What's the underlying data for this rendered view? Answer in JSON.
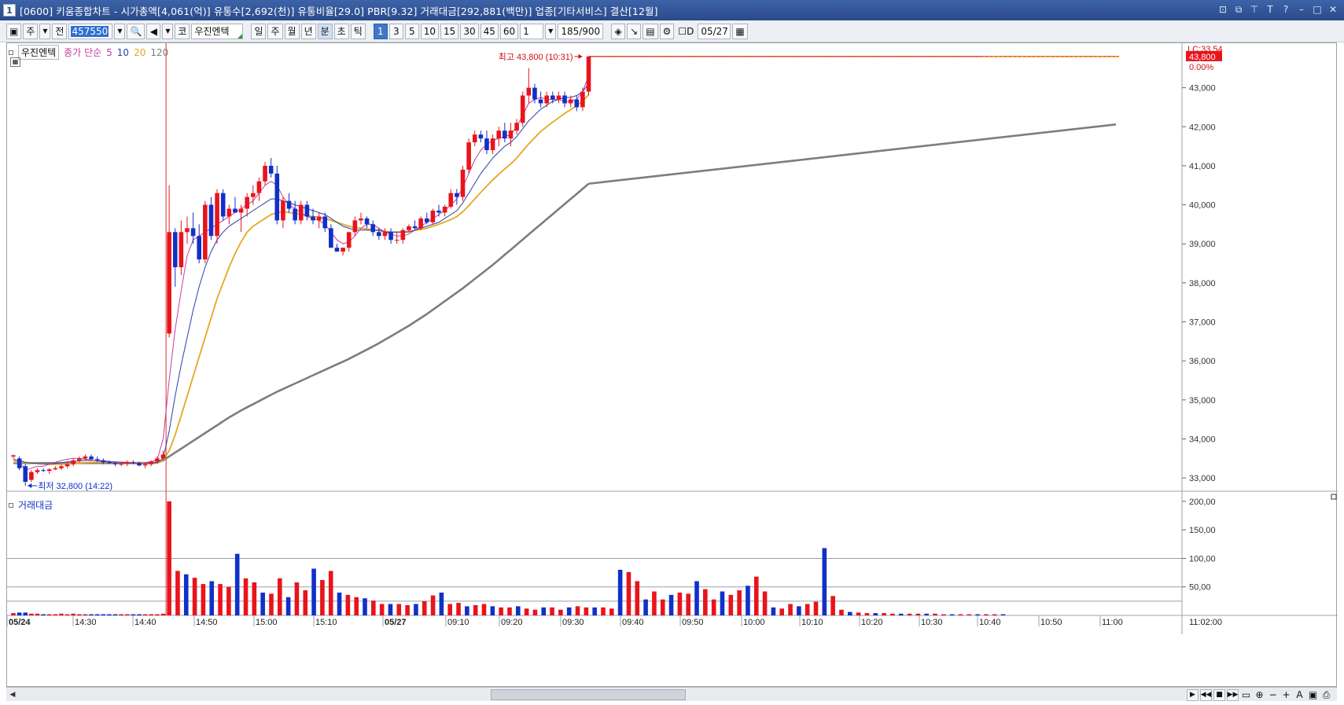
{
  "window": {
    "number": "1",
    "title": "[0600] 키움종합차트 - 시가총액[4,061(억)] 유통수[2,692(천)] 유통비율[29.0] PBR[9.32] 거래대금[292,881(백만)] 업종[기타서비스] 결산[12월]",
    "buttons": [
      "⊡",
      "⧉",
      "⊤",
      "T",
      "?",
      "–",
      "□",
      "✕"
    ]
  },
  "toolbar": {
    "period_btn": "주",
    "range_btn": "전",
    "code_value": "457550",
    "market_btn": "코",
    "stock_name": "우진엔텍",
    "period_tabs": [
      "일",
      "주",
      "월",
      "년",
      "분",
      "초",
      "틱"
    ],
    "active_period": "분",
    "minute_intervals": [
      "1",
      "3",
      "5",
      "10",
      "15",
      "30",
      "45",
      "60"
    ],
    "active_interval": "1",
    "count_value": "1",
    "bar_count": "185/900",
    "d_label": "D",
    "date_value": "05/27"
  },
  "price_panel": {
    "stock_name": "우진엔텍",
    "ma_label": "종가 단순",
    "ma_periods": [
      {
        "label": "5",
        "color": "#c43ca0"
      },
      {
        "label": "10",
        "color": "#2a3fa8"
      },
      {
        "label": "20",
        "color": "#e6a820"
      },
      {
        "label": "120",
        "color": "#7d7d7d"
      }
    ],
    "lc_label": "LC:33.54",
    "current_price": "43,800",
    "current_change": "0.00%",
    "high_marker": "최고 43,800 (10:31)",
    "low_marker": "최저 32,800 (14:22)",
    "y_ticks": [
      "43,000",
      "42,000",
      "41,000",
      "40,000",
      "39,000",
      "38,000",
      "37,000",
      "36,000",
      "35,000",
      "34,000",
      "33,000"
    ]
  },
  "volume_panel": {
    "label": "거래대금",
    "y_ticks": [
      "200,00",
      "150,00",
      "100,00",
      "50,00"
    ]
  },
  "x_axis": {
    "labels": [
      "05/24",
      "14:30",
      "14:40",
      "14:50",
      "15:00",
      "15:10",
      "05/27",
      "09:10",
      "09:20",
      "09:30",
      "09:40",
      "09:50",
      "10:00",
      "10:10",
      "10:20",
      "10:30",
      "10:40",
      "10:50",
      "11:00"
    ],
    "right_label": "11:02:00"
  },
  "colors": {
    "up": "#e8141c",
    "down": "#1030c8",
    "ma5": "#c43ca0",
    "ma10": "#2a3fa8",
    "ma20": "#e6a820",
    "ma120": "#7d7d7d",
    "title_bar": "#2f5295"
  },
  "chart_data": {
    "type": "candlestick",
    "title": "우진엔텍",
    "high": 43800,
    "low": 32800,
    "ylim": [
      32700,
      44100
    ],
    "candles": [
      [
        33550,
        33600,
        33500,
        33580
      ],
      [
        33500,
        33550,
        33200,
        33250
      ],
      [
        33300,
        33350,
        32800,
        32900
      ],
      [
        32950,
        33200,
        32900,
        33150
      ],
      [
        33150,
        33250,
        33100,
        33200
      ],
      [
        33200,
        33250,
        33150,
        33180
      ],
      [
        33180,
        33250,
        33100,
        33220
      ],
      [
        33220,
        33300,
        33200,
        33250
      ],
      [
        33250,
        33350,
        33200,
        33300
      ],
      [
        33300,
        33400,
        33250,
        33350
      ],
      [
        33350,
        33500,
        33300,
        33450
      ],
      [
        33450,
        33550,
        33400,
        33500
      ],
      [
        33500,
        33600,
        33450,
        33550
      ],
      [
        33550,
        33600,
        33450,
        33480
      ],
      [
        33480,
        33550,
        33400,
        33450
      ],
      [
        33450,
        33500,
        33350,
        33400
      ],
      [
        33400,
        33450,
        33350,
        33380
      ],
      [
        33380,
        33420,
        33300,
        33350
      ],
      [
        33350,
        33400,
        33300,
        33360
      ],
      [
        33360,
        33450,
        33300,
        33400
      ],
      [
        33400,
        33450,
        33350,
        33380
      ],
      [
        33380,
        33420,
        33300,
        33320
      ],
      [
        33320,
        33400,
        33250,
        33350
      ],
      [
        33350,
        33450,
        33300,
        33420
      ],
      [
        33420,
        33550,
        33400,
        33500
      ],
      [
        33500,
        33700,
        33450,
        33600
      ],
      [
        36700,
        40500,
        36600,
        39300
      ],
      [
        39300,
        39400,
        37900,
        38400
      ],
      [
        38400,
        39600,
        38200,
        39300
      ],
      [
        39300,
        39700,
        39000,
        39400
      ],
      [
        39400,
        39800,
        39000,
        39200
      ],
      [
        39200,
        39500,
        38500,
        38600
      ],
      [
        38600,
        40100,
        38500,
        40000
      ],
      [
        40000,
        40200,
        39100,
        39200
      ],
      [
        39200,
        40400,
        39000,
        40300
      ],
      [
        40300,
        40400,
        39600,
        39700
      ],
      [
        39700,
        40000,
        39500,
        39900
      ],
      [
        39900,
        40200,
        39800,
        39800
      ],
      [
        39800,
        40000,
        39300,
        39900
      ],
      [
        39900,
        40300,
        39700,
        40200
      ],
      [
        40200,
        40500,
        40000,
        40300
      ],
      [
        40300,
        40700,
        40100,
        40600
      ],
      [
        40600,
        41100,
        40500,
        41000
      ],
      [
        41000,
        41200,
        40700,
        40800
      ],
      [
        40800,
        41000,
        39500,
        39600
      ],
      [
        39600,
        40200,
        39400,
        40100
      ],
      [
        40100,
        40300,
        39800,
        39900
      ],
      [
        39900,
        40100,
        39500,
        39600
      ],
      [
        39600,
        40100,
        39500,
        40000
      ],
      [
        40000,
        40100,
        39600,
        39700
      ],
      [
        39700,
        39900,
        39500,
        39600
      ],
      [
        39600,
        39800,
        39400,
        39700
      ],
      [
        39700,
        39800,
        39300,
        39400
      ],
      [
        39400,
        39500,
        38900,
        38900
      ],
      [
        38900,
        39000,
        38800,
        38800
      ],
      [
        38800,
        38900,
        38700,
        38900
      ],
      [
        38900,
        39300,
        38800,
        39300
      ],
      [
        39300,
        39700,
        39200,
        39600
      ],
      [
        39600,
        39800,
        39500,
        39650
      ],
      [
        39650,
        39700,
        39400,
        39500
      ],
      [
        39500,
        39600,
        39200,
        39300
      ],
      [
        39300,
        39400,
        39100,
        39200
      ],
      [
        39200,
        39400,
        39100,
        39300
      ],
      [
        39300,
        39400,
        39000,
        39100
      ],
      [
        39100,
        39300,
        39000,
        39100
      ],
      [
        39100,
        39400,
        39000,
        39350
      ],
      [
        39350,
        39500,
        39300,
        39450
      ],
      [
        39450,
        39600,
        39350,
        39400
      ],
      [
        39400,
        39700,
        39350,
        39650
      ],
      [
        39650,
        39800,
        39500,
        39550
      ],
      [
        39550,
        39900,
        39500,
        39850
      ],
      [
        39850,
        40000,
        39700,
        39800
      ],
      [
        39800,
        40000,
        39700,
        39950
      ],
      [
        39950,
        40400,
        39900,
        40300
      ],
      [
        40300,
        40400,
        40000,
        40200
      ],
      [
        40200,
        41000,
        40100,
        40900
      ],
      [
        40900,
        41700,
        40800,
        41600
      ],
      [
        41600,
        41900,
        41500,
        41800
      ],
      [
        41800,
        41900,
        41600,
        41700
      ],
      [
        41700,
        41900,
        41300,
        41400
      ],
      [
        41400,
        41800,
        41300,
        41700
      ],
      [
        41700,
        42000,
        41500,
        41900
      ],
      [
        41900,
        42100,
        41600,
        41700
      ],
      [
        41700,
        42100,
        41500,
        41900
      ],
      [
        41900,
        42200,
        41800,
        42100
      ],
      [
        42100,
        42900,
        42000,
        42800
      ],
      [
        42800,
        43500,
        42600,
        43000
      ],
      [
        43000,
        43100,
        42600,
        42700
      ],
      [
        42700,
        42900,
        42500,
        42600
      ],
      [
        42600,
        42900,
        42500,
        42800
      ],
      [
        42800,
        42900,
        42600,
        42700
      ],
      [
        42700,
        42900,
        42600,
        42800
      ],
      [
        42800,
        42900,
        42500,
        42600
      ],
      [
        42600,
        42800,
        42500,
        42700
      ],
      [
        42700,
        42800,
        42400,
        42500
      ],
      [
        42500,
        43000,
        42400,
        42900
      ],
      [
        42900,
        43800,
        42800,
        43800
      ]
    ],
    "volumes": [
      4,
      5,
      5,
      3,
      3,
      2,
      2,
      2,
      3,
      2,
      3,
      2,
      2,
      2,
      2,
      2,
      2,
      2,
      2,
      2,
      2,
      2,
      2,
      2,
      2,
      3,
      200,
      78,
      72,
      66,
      55,
      60,
      55,
      50,
      108,
      65,
      58,
      40,
      38,
      65,
      32,
      58,
      44,
      82,
      62,
      78,
      40,
      36,
      32,
      30,
      26,
      20,
      20,
      20,
      18,
      20,
      25,
      35,
      40,
      20,
      22,
      16,
      18,
      20,
      16,
      14,
      14,
      16,
      12,
      10,
      14,
      14,
      10,
      14,
      16,
      14,
      14,
      14,
      12,
      80,
      76,
      60,
      28,
      42,
      28,
      36,
      40,
      38,
      60,
      46,
      28,
      42,
      36,
      44,
      52,
      68,
      42,
      14,
      12,
      20,
      16,
      20,
      24,
      118,
      34,
      10,
      6,
      5,
      4,
      4,
      4,
      3,
      3,
      3,
      3,
      3,
      3,
      2,
      2,
      2,
      2,
      2,
      2,
      2,
      2
    ],
    "ma5": [
      33500,
      33400,
      33200,
      33250,
      33300,
      33300,
      33350,
      33400,
      33450,
      33480,
      33500,
      33500,
      33480,
      33460,
      33440,
      33420,
      33400,
      33380,
      33380,
      33370,
      33370,
      33370,
      33390,
      33420,
      33470,
      34000,
      35500,
      36800,
      37800,
      38700,
      39100,
      39200,
      39300,
      39400,
      39500,
      39600,
      39700,
      39800,
      39900,
      40000,
      40100,
      40300,
      40500,
      40600,
      40500,
      40200,
      40000,
      39900,
      39800,
      39700,
      39650,
      39600,
      39500,
      39300,
      39100,
      39000,
      39050,
      39200,
      39400,
      39500,
      39500,
      39400,
      39300,
      39250,
      39200,
      39200,
      39250,
      39350,
      39450,
      39550,
      39650,
      39750,
      39850,
      40000,
      40150,
      40450,
      40800,
      41150,
      41400,
      41550,
      41650,
      41700,
      41750,
      41800,
      42000,
      42300,
      42600,
      42700,
      42750,
      42700,
      42700,
      42700,
      42650,
      42650,
      42700,
      42900,
      43300
    ],
    "ma10": [
      33450,
      33450,
      33400,
      33380,
      33370,
      33360,
      33360,
      33370,
      33390,
      33410,
      33430,
      33440,
      33450,
      33450,
      33450,
      33440,
      33420,
      33410,
      33400,
      33390,
      33380,
      33380,
      33380,
      33390,
      33400,
      33500,
      34200,
      35100,
      35900,
      36600,
      37300,
      37900,
      38400,
      38800,
      39100,
      39300,
      39450,
      39550,
      39650,
      39750,
      39850,
      39950,
      40050,
      40150,
      40150,
      40100,
      40050,
      40000,
      39950,
      39900,
      39850,
      39800,
      39750,
      39650,
      39550,
      39450,
      39400,
      39350,
      39350,
      39350,
      39350,
      39350,
      39300,
      39300,
      39300,
      39300,
      39300,
      39350,
      39400,
      39450,
      39500,
      39550,
      39650,
      39750,
      39850,
      40050,
      40300,
      40550,
      40800,
      41000,
      41200,
      41350,
      41500,
      41600,
      41750,
      41950,
      42150,
      42300,
      42450,
      42550,
      42650,
      42700,
      42750,
      42750,
      42800,
      42900,
      43100
    ],
    "ma20": [
      33400,
      33400,
      33390,
      33380,
      33370,
      33360,
      33350,
      33350,
      33350,
      33360,
      33370,
      33380,
      33390,
      33400,
      33400,
      33400,
      33400,
      33400,
      33400,
      33400,
      33390,
      33390,
      33390,
      33390,
      33400,
      33450,
      33700,
      34100,
      34600,
      35100,
      35600,
      36100,
      36600,
      37100,
      37600,
      38000,
      38400,
      38750,
      39050,
      39300,
      39450,
      39550,
      39650,
      39750,
      39800,
      39820,
      39800,
      39780,
      39750,
      39720,
      39700,
      39680,
      39650,
      39600,
      39550,
      39500,
      39450,
      39420,
      39400,
      39380,
      39360,
      39340,
      39320,
      39300,
      39300,
      39300,
      39320,
      39340,
      39370,
      39400,
      39450,
      39500,
      39560,
      39620,
      39700,
      39820,
      39980,
      40150,
      40320,
      40480,
      40640,
      40780,
      40920,
      41050,
      41200,
      41380,
      41560,
      41720,
      41880,
      42000,
      42120,
      42230,
      42340,
      42440,
      42540,
      42660,
      42820
    ],
    "ma120": [
      33380,
      33380,
      33380,
      33380,
      33380,
      33380,
      33380,
      33380,
      33380,
      33380,
      33380,
      33380,
      33380,
      33380,
      33380,
      33380,
      33380,
      33380,
      33380,
      33380,
      33380,
      33380,
      33380,
      33380,
      33390,
      33450,
      33550,
      33650,
      33750,
      33850,
      33950,
      34050,
      34150,
      34250,
      34350,
      34450,
      34550,
      34640,
      34730,
      34810,
      34890,
      34970,
      35050,
      35130,
      35210,
      35280,
      35350,
      35420,
      35490,
      35560,
      35630,
      35700,
      35770,
      35840,
      35910,
      35980,
      36050,
      36130,
      36210,
      36290,
      36370,
      36450,
      36540,
      36630,
      36720,
      36810,
      36900,
      37000,
      37100,
      37200,
      37310,
      37420,
      37530,
      37640,
      37750,
      37860,
      37980,
      38100,
      38220,
      38340,
      38460,
      38590,
      38720,
      38850,
      38980,
      39110,
      39240,
      39370,
      39500,
      39630,
      39760,
      39890,
      40020,
      40150,
      40280,
      40410,
      40540
    ]
  }
}
